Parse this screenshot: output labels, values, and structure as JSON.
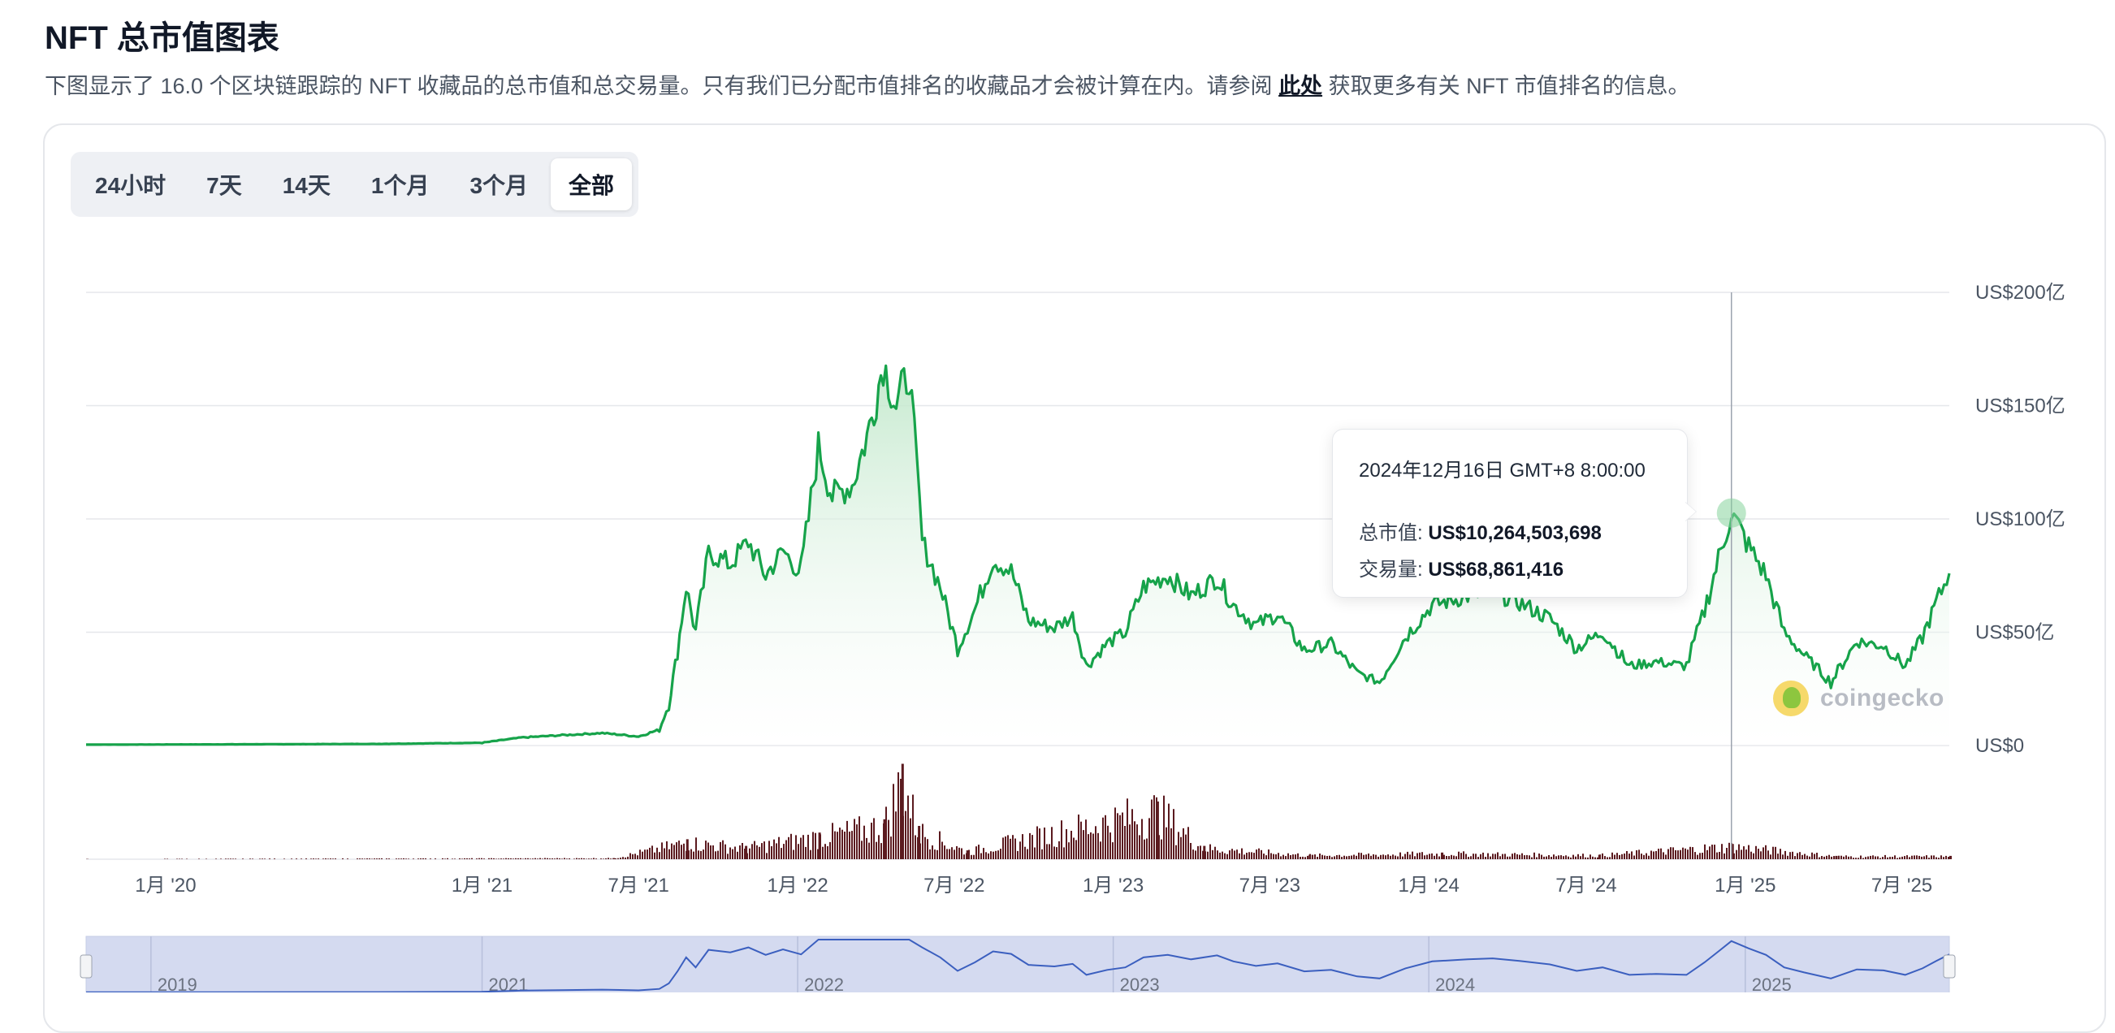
{
  "page": {
    "title": "NFT 总市值图表",
    "description_before": "下图显示了 16.0 个区块链跟踪的 NFT 收藏品的总市值和总交易量。只有我们已分配市值排名的收藏品才会被计算在内。请参阅 ",
    "description_link": "此处",
    "description_after": " 获取更多有关 NFT 市值排名的信息。"
  },
  "tabs": [
    "24小时",
    "7天",
    "14天",
    "1个月",
    "3个月",
    "全部"
  ],
  "active_tab": "全部",
  "tooltip": {
    "date": "2024年12月16日 GMT+8 8:00:00",
    "market_cap_label": "总市值: ",
    "market_cap_value": "US$10,264,503,698",
    "volume_label": "交易量: ",
    "volume_value": "US$68,861,416"
  },
  "brand": {
    "name": "coingecko"
  },
  "colors": {
    "line": "#16a34a",
    "area_top": "#bfe7c9",
    "volume": "#5b1a1f",
    "navigator_fill": "#d4daf0",
    "navigator_line": "#3b5fbf",
    "grid": "#e5e7eb"
  },
  "chart_data": {
    "type": "line",
    "title": "",
    "ylabel": "",
    "xlabel": "",
    "ylim": [
      0,
      20000000000
    ],
    "y_ticks": [
      {
        "value": 0,
        "label": "US$0"
      },
      {
        "value": 5000000000,
        "label": "US$50亿"
      },
      {
        "value": 10000000000,
        "label": "US$100亿"
      },
      {
        "value": 15000000000,
        "label": "US$150亿"
      },
      {
        "value": 20000000000,
        "label": "US$200亿"
      }
    ],
    "x_range": [
      "2019-10-01",
      "2025-08-25"
    ],
    "x_ticks": [
      {
        "date": "2020-01-01",
        "label": "1月 '20"
      },
      {
        "date": "2021-01-01",
        "label": "1月 '21"
      },
      {
        "date": "2021-07-01",
        "label": "7月 '21"
      },
      {
        "date": "2022-01-01",
        "label": "1月 '22"
      },
      {
        "date": "2022-07-01",
        "label": "7月 '22"
      },
      {
        "date": "2023-01-01",
        "label": "1月 '23"
      },
      {
        "date": "2023-07-01",
        "label": "7月 '23"
      },
      {
        "date": "2024-01-01",
        "label": "1月 '24"
      },
      {
        "date": "2024-07-01",
        "label": "7月 '24"
      },
      {
        "date": "2025-01-01",
        "label": "1月 '25"
      },
      {
        "date": "2025-07-01",
        "label": "7月 '25"
      }
    ],
    "series": [
      {
        "name": "总市值",
        "points": [
          [
            "2019-10-01",
            40000000
          ],
          [
            "2020-03-01",
            50000000
          ],
          [
            "2020-09-01",
            70000000
          ],
          [
            "2021-01-01",
            120000000
          ],
          [
            "2021-02-15",
            350000000
          ],
          [
            "2021-04-01",
            450000000
          ],
          [
            "2021-05-20",
            550000000
          ],
          [
            "2021-07-01",
            400000000
          ],
          [
            "2021-07-25",
            700000000
          ],
          [
            "2021-08-05",
            1800000000
          ],
          [
            "2021-08-15",
            4200000000
          ],
          [
            "2021-08-25",
            7000000000
          ],
          [
            "2021-09-05",
            5000000000
          ],
          [
            "2021-09-20",
            8500000000
          ],
          [
            "2021-10-15",
            8000000000
          ],
          [
            "2021-11-05",
            9000000000
          ],
          [
            "2021-11-25",
            7500000000
          ],
          [
            "2021-12-15",
            8600000000
          ],
          [
            "2022-01-05",
            7600000000
          ],
          [
            "2022-01-25",
            13200000000
          ],
          [
            "2022-02-10",
            11000000000
          ],
          [
            "2022-03-05",
            11500000000
          ],
          [
            "2022-03-25",
            14000000000
          ],
          [
            "2022-04-10",
            16900000000
          ],
          [
            "2022-04-25",
            15000000000
          ],
          [
            "2022-05-10",
            16500000000
          ],
          [
            "2022-05-25",
            9000000000
          ],
          [
            "2022-06-15",
            7000000000
          ],
          [
            "2022-07-05",
            4300000000
          ],
          [
            "2022-07-25",
            6000000000
          ],
          [
            "2022-08-15",
            8200000000
          ],
          [
            "2022-09-05",
            7700000000
          ],
          [
            "2022-09-25",
            5500000000
          ],
          [
            "2022-10-25",
            5200000000
          ],
          [
            "2022-11-15",
            5700000000
          ],
          [
            "2022-12-01",
            3500000000
          ],
          [
            "2022-12-25",
            4500000000
          ],
          [
            "2023-01-15",
            5000000000
          ],
          [
            "2023-02-05",
            7000000000
          ],
          [
            "2023-03-05",
            7500000000
          ],
          [
            "2023-04-01",
            6600000000
          ],
          [
            "2023-05-01",
            7400000000
          ],
          [
            "2023-05-20",
            6200000000
          ],
          [
            "2023-06-15",
            5300000000
          ],
          [
            "2023-07-10",
            5800000000
          ],
          [
            "2023-08-10",
            4200000000
          ],
          [
            "2023-09-10",
            4500000000
          ],
          [
            "2023-10-10",
            3200000000
          ],
          [
            "2023-11-05",
            2800000000
          ],
          [
            "2023-12-05",
            4800000000
          ],
          [
            "2024-01-05",
            6200000000
          ],
          [
            "2024-02-15",
            6600000000
          ],
          [
            "2024-03-15",
            6800000000
          ],
          [
            "2024-04-15",
            6300000000
          ],
          [
            "2024-05-20",
            5600000000
          ],
          [
            "2024-06-20",
            4300000000
          ],
          [
            "2024-07-20",
            5000000000
          ],
          [
            "2024-08-20",
            3500000000
          ],
          [
            "2024-09-20",
            3700000000
          ],
          [
            "2024-10-25",
            3500000000
          ],
          [
            "2024-11-15",
            6000000000
          ],
          [
            "2024-12-01",
            8200000000
          ],
          [
            "2024-12-16",
            10264503698
          ],
          [
            "2025-01-05",
            8800000000
          ],
          [
            "2025-01-25",
            7500000000
          ],
          [
            "2025-02-15",
            5000000000
          ],
          [
            "2025-03-10",
            4000000000
          ],
          [
            "2025-04-10",
            2800000000
          ],
          [
            "2025-05-10",
            4600000000
          ],
          [
            "2025-06-10",
            4400000000
          ],
          [
            "2025-07-05",
            3500000000
          ],
          [
            "2025-07-25",
            4800000000
          ],
          [
            "2025-08-10",
            6300000000
          ],
          [
            "2025-08-25",
            7600000000
          ]
        ]
      },
      {
        "name": "交易量",
        "points": [
          [
            "2019-10-01",
            1000000
          ],
          [
            "2021-06-01",
            5000000
          ],
          [
            "2021-08-25",
            90000000
          ],
          [
            "2021-11-01",
            60000000
          ],
          [
            "2022-01-25",
            120000000
          ],
          [
            "2022-04-10",
            180000000
          ],
          [
            "2022-05-01",
            430000000
          ],
          [
            "2022-05-20",
            150000000
          ],
          [
            "2022-07-15",
            40000000
          ],
          [
            "2023-02-20",
            260000000
          ],
          [
            "2023-04-15",
            60000000
          ],
          [
            "2023-08-15",
            20000000
          ],
          [
            "2024-01-15",
            30000000
          ],
          [
            "2024-07-15",
            20000000
          ],
          [
            "2024-12-16",
            68861416
          ],
          [
            "2025-04-15",
            15000000
          ],
          [
            "2025-08-25",
            15000000
          ]
        ]
      }
    ],
    "navigator": {
      "year_labels": [
        "2019",
        "2021",
        "2022",
        "2023",
        "2024",
        "2025"
      ]
    }
  }
}
